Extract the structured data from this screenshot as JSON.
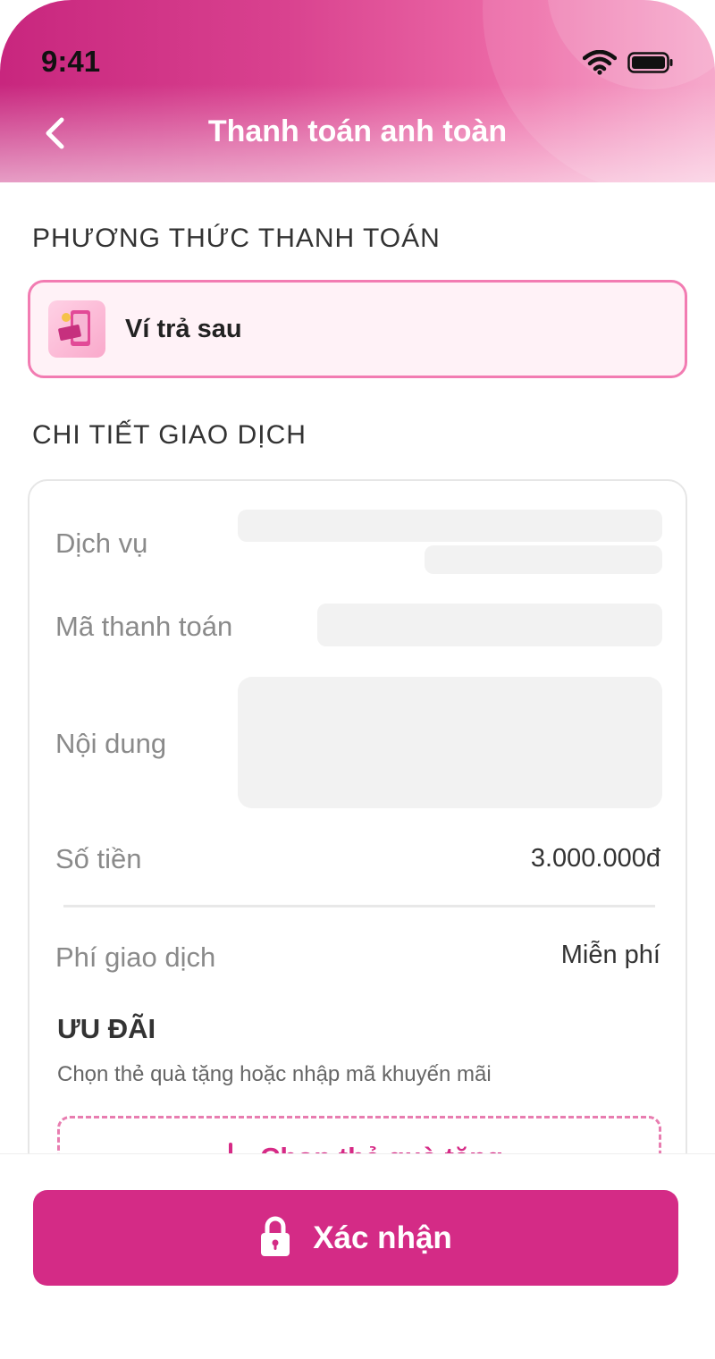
{
  "status_bar": {
    "time": "9:41",
    "icons": [
      "wifi-icon",
      "battery-icon"
    ]
  },
  "header": {
    "title": "Thanh toán anh toàn",
    "back_icon": "chevron-left-icon",
    "gradient_colors": [
      "#c8267e",
      "#ee6ea9",
      "#f5a0c6"
    ]
  },
  "payment_method": {
    "section_title": "PHƯƠNG THỨC THANH TOÁN",
    "selected": {
      "label": "Ví trả sau",
      "icon": "wallet-icon"
    }
  },
  "transaction_details": {
    "section_title": "CHI TIẾT GIAO DỊCH",
    "rows": [
      {
        "label": "Dịch vụ",
        "value": ""
      },
      {
        "label": "Mã thanh toán",
        "value": ""
      },
      {
        "label": "Nội dung",
        "value": ""
      },
      {
        "label": "Số tiền",
        "value": "3.000.000đ"
      },
      {
        "label": "Phí giao dịch",
        "value": "Miễn phí"
      }
    ]
  },
  "promo": {
    "title": "ƯU ĐÃI",
    "subtitle": "Chọn thẻ quà tặng hoặc nhập mã khuyến mãi",
    "gift_button_label": "Chọn thẻ quà tặng",
    "gift_icon": "plus-icon"
  },
  "footer": {
    "confirm_label": "Xác nhận",
    "confirm_icon": "lock-icon"
  },
  "colors": {
    "accent": "#d42b86",
    "card_border": "#f27cb2",
    "card_bg": "#fff2f7"
  }
}
